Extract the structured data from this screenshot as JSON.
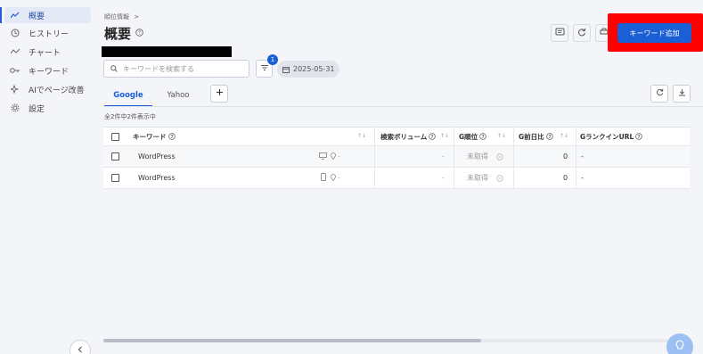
{
  "sidebar": {
    "items": [
      {
        "label": "概要",
        "icon": "trend-icon",
        "active": true
      },
      {
        "label": "ヒストリー",
        "icon": "history-icon"
      },
      {
        "label": "チャート",
        "icon": "chart-icon"
      },
      {
        "label": "キーワード",
        "icon": "key-icon"
      },
      {
        "label": "AIでページ改善",
        "icon": "sparkle-icon"
      },
      {
        "label": "設定",
        "icon": "gear-icon"
      }
    ]
  },
  "header": {
    "breadcrumb": "順位情報",
    "breadcrumb_sep": ">",
    "title": "概要",
    "add_keyword_label": "キーワード追加"
  },
  "toolbar": {
    "search_placeholder": "キーワードを検索する",
    "filter_count": "1",
    "date": "2025-05-31"
  },
  "tabs": [
    {
      "label": "Google",
      "active": true
    },
    {
      "label": "Yahoo",
      "active": false
    }
  ],
  "count_text": "全2件中2件表示中",
  "table": {
    "columns": [
      "キーワード",
      "検索ボリューム",
      "G順位",
      "G前日比",
      "GランクインURL"
    ],
    "rows": [
      {
        "keyword": "WordPress",
        "device": "desktop-icon",
        "volume": "-",
        "rank": "未取得",
        "diff": "0",
        "url": "-",
        "loc": "-"
      },
      {
        "keyword": "WordPress",
        "device": "mobile-icon",
        "volume": "-",
        "rank": "未取得",
        "diff": "0",
        "url": "-",
        "loc": "-"
      }
    ]
  },
  "colors": {
    "accent": "#1a5fd6",
    "highlight": "#ff0000",
    "background": "#f4f5f8"
  }
}
